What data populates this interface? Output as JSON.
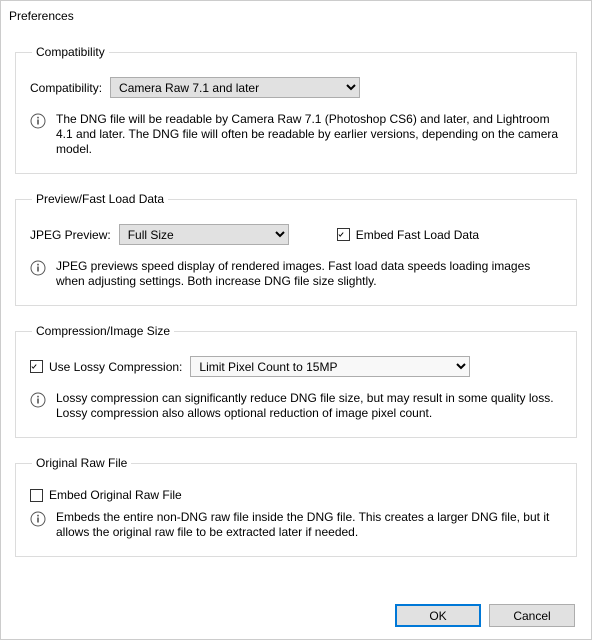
{
  "window": {
    "title": "Preferences"
  },
  "group_compat": {
    "legend": "Compatibility",
    "label": "Compatibility:",
    "selected": "Camera Raw 7.1 and later",
    "info": "The DNG file will be readable by Camera Raw 7.1 (Photoshop CS6) and later, and Lightroom 4.1 and later. The DNG file will often be readable by earlier versions, depending on the camera model."
  },
  "group_preview": {
    "legend": "Preview/Fast Load Data",
    "label": "JPEG Preview:",
    "selected": "Full Size",
    "embed_fast_label": "Embed Fast Load Data",
    "embed_fast_checked": true,
    "info": "JPEG previews speed display of rendered images.  Fast load data speeds loading images when adjusting settings.  Both increase DNG file size slightly."
  },
  "group_compression": {
    "legend": "Compression/Image Size",
    "lossy_label": "Use Lossy Compression:",
    "lossy_checked": true,
    "selected": "Limit Pixel Count to 15MP",
    "info": "Lossy compression can significantly reduce DNG file size, but may result in some quality loss.  Lossy compression also allows optional reduction of image pixel count."
  },
  "group_original": {
    "legend": "Original Raw File",
    "embed_label": "Embed Original Raw File",
    "embed_checked": false,
    "info": "Embeds the entire non-DNG raw file inside the DNG file.  This creates a larger DNG file, but it allows the original raw file to be extracted later if needed."
  },
  "buttons": {
    "ok": "OK",
    "cancel": "Cancel"
  }
}
